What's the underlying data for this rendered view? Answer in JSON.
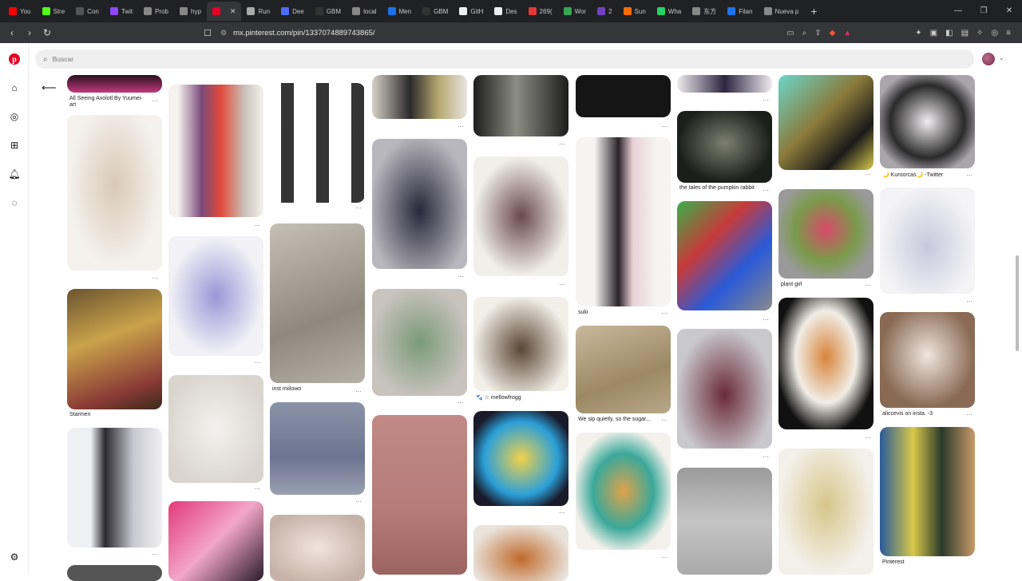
{
  "browser": {
    "tabs": [
      {
        "label": "You",
        "color": "#ff0000"
      },
      {
        "label": "Stre",
        "color": "#53fc18"
      },
      {
        "label": "Con",
        "color": "#555555"
      },
      {
        "label": "Twit",
        "color": "#9146ff"
      },
      {
        "label": "Prob",
        "color": "#888888"
      },
      {
        "label": "hyp",
        "color": "#888888"
      },
      {
        "label": "",
        "color": "#e60023",
        "active": true
      },
      {
        "label": "Run",
        "color": "#aaaaaa"
      },
      {
        "label": "Dee",
        "color": "#4d6bfe"
      },
      {
        "label": "GBM",
        "color": "#333333"
      },
      {
        "label": "local",
        "color": "#888888"
      },
      {
        "label": "Men",
        "color": "#1a73e8"
      },
      {
        "label": "GBM",
        "color": "#333333"
      },
      {
        "label": "GitH",
        "color": "#eeeeee"
      },
      {
        "label": "Des",
        "color": "#eeeeee"
      },
      {
        "label": "269(",
        "color": "#e53935"
      },
      {
        "label": "Wor",
        "color": "#34a853"
      },
      {
        "label": "2",
        "color": "#6f42c1"
      },
      {
        "label": "Sun",
        "color": "#ff6d00"
      },
      {
        "label": "Wha",
        "color": "#25d366"
      },
      {
        "label": "东方",
        "color": "#888888"
      },
      {
        "label": "Filan",
        "color": "#1a73e8"
      },
      {
        "label": "Nueva p",
        "color": "#888888"
      }
    ],
    "new_tab_icon": "+",
    "url": "mx.pinterest.com/pin/1337074889743865/"
  },
  "search": {
    "placeholder": "Buscar"
  },
  "rail_icons": [
    "pinterest-logo",
    "home-icon",
    "explore-icon",
    "create-icon",
    "notifications-icon",
    "messages-icon",
    "settings-icon"
  ],
  "captions": {
    "c1": "All Seeing Axolotl By Yuumei-",
    "c1b": "art",
    "c2": "Starmen",
    "c3": "inst miilowo",
    "c4": "🐾 ☆ mellowfrogg",
    "c5": "We sip quietly, so the sugar...",
    "c6": "suki",
    "c7": "the tales of the pumpkin rabbit",
    "c8": "plant girl",
    "c9": "🌙 Kuroorcas🌙 -Twitter",
    "c10": "aliccevis on insta. -3",
    "c11": "Pinterest"
  },
  "more_glyph": "···"
}
